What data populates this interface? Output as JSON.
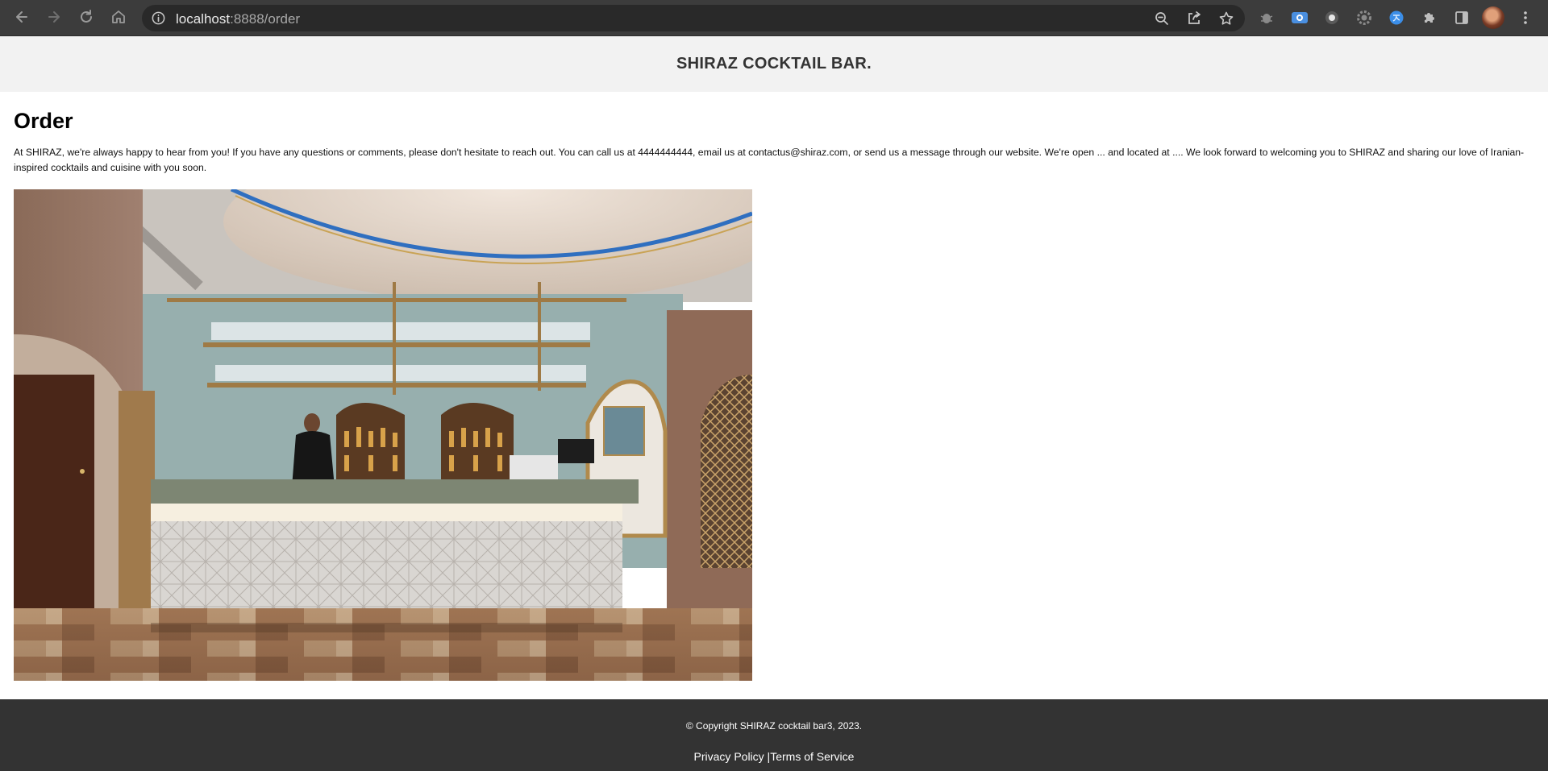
{
  "browser": {
    "url_host": "localhost",
    "url_path": ":8888/order"
  },
  "header": {
    "title": "SHIRAZ COCKTAIL BAR."
  },
  "main": {
    "heading": "Order",
    "intro": "At SHIRAZ, we're always happy to hear from you! If you have any questions or comments, please don't hesitate to reach out. You can call us at 4444444444, email us at contactus@shiraz.com, or send us a message through our website. We're open ... and located at .... We look forward to welcoming you to SHIRAZ and sharing our love of Iranian-inspired cocktails and cuisine with you soon."
  },
  "footer": {
    "copyright": "© Copyright SHIRAZ cocktail bar3, 2023.",
    "privacy": "Privacy Policy",
    "separator": " |",
    "terms": "Terms of Service"
  },
  "icons": {
    "back": "arrow-left-icon",
    "forward": "arrow-right-icon",
    "reload": "reload-icon",
    "home": "home-icon",
    "info": "info-icon",
    "zoom": "zoom-icon",
    "share": "share-icon",
    "bookmark": "star-icon",
    "extensions": "puzzle-icon",
    "side_panel": "side-panel-icon",
    "menu": "kebab-menu-icon"
  },
  "colors": {
    "chrome": "#3c3c3c",
    "header_bg": "#f2f2f2",
    "footer_bg": "#333333"
  }
}
